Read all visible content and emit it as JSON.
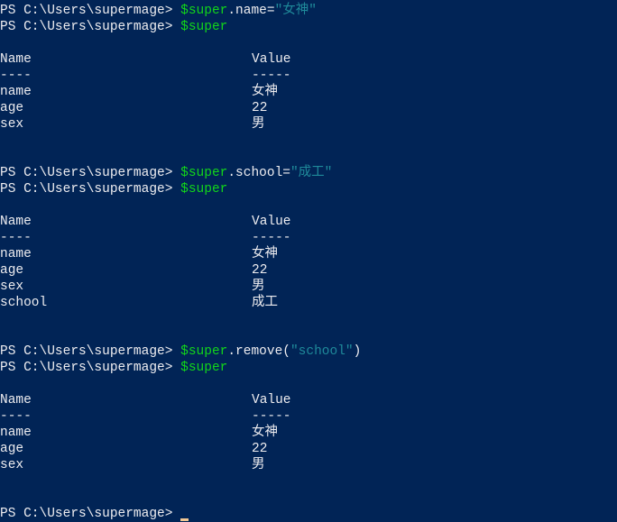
{
  "prompt": "PS C:\\Users\\supermage> ",
  "table_header": {
    "name": "Name",
    "value": "Value",
    "name_rule": "----",
    "value_rule": "-----"
  },
  "blocks": [
    {
      "cmd1": {
        "var": "$super",
        "rest": ".name=",
        "str": "\"女神\""
      },
      "cmd2": {
        "var": "$super"
      },
      "rows": [
        {
          "name": "name",
          "value": "女神"
        },
        {
          "name": "age",
          "value": "22"
        },
        {
          "name": "sex",
          "value": "男"
        }
      ]
    },
    {
      "cmd1": {
        "var": "$super",
        "rest": ".school=",
        "str": "\"成工\""
      },
      "cmd2": {
        "var": "$super"
      },
      "rows": [
        {
          "name": "name",
          "value": "女神"
        },
        {
          "name": "age",
          "value": "22"
        },
        {
          "name": "sex",
          "value": "男"
        },
        {
          "name": "school",
          "value": "成工"
        }
      ]
    },
    {
      "cmd1": {
        "var": "$super",
        "rest": ".remove(",
        "str": "\"school\"",
        "tail": ")"
      },
      "cmd2": {
        "var": "$super"
      },
      "rows": [
        {
          "name": "name",
          "value": "女神"
        },
        {
          "name": "age",
          "value": "22"
        },
        {
          "name": "sex",
          "value": "男"
        }
      ]
    }
  ],
  "colors": {
    "background": "#012456",
    "command": "#12d61a",
    "string": "#1f8a9a",
    "text": "#eeedf0",
    "cursor": "#f2c894"
  }
}
